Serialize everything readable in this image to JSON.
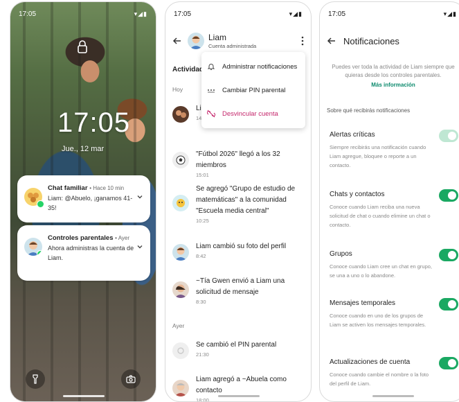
{
  "lockscreen": {
    "status_time": "17:05",
    "status_icons": "▾◢▮",
    "time": "17:05",
    "date": "Jue., 12 mar",
    "notifications": [
      {
        "title": "Chat familiar",
        "meta": "• Hace 10 min",
        "text": "Liam: @Abuelo, ¡ganamos 41-35!"
      },
      {
        "title": "Controles parentales",
        "meta": "• Ayer",
        "text": "Ahora administras la cuenta de Liam."
      }
    ]
  },
  "chatinfo": {
    "status_time": "17:05",
    "status_icons": "▾◢▮",
    "name": "Liam",
    "subtitle": "Cuenta administrada",
    "section": "Actividad",
    "menu": [
      {
        "label": "Administrar notificaciones",
        "icon": "bell-icon"
      },
      {
        "label": "Cambiar PIN parental",
        "icon": "pin-dots-icon"
      },
      {
        "label": "Desvincular cuenta",
        "icon": "unlink-icon"
      }
    ],
    "day_today": "Hoy",
    "day_yesterday": "Ayer",
    "activity": [
      {
        "text": "Li en",
        "time": "14:"
      },
      {
        "text": "\"Fútbol 2026\" llegó a los 32 miembros",
        "time": "15:01"
      },
      {
        "text": "Se agregó \"Grupo de estudio de matemáticas\" a la comunidad \"Escuela media central\"",
        "time": "10:25"
      },
      {
        "text": "Liam cambió su foto del perfil",
        "time": "8:42"
      },
      {
        "text": "~Tía Gwen envió a Liam una solicitud de mensaje",
        "time": "8:30"
      },
      {
        "text": "Se cambió el PIN parental",
        "time": "21:30"
      },
      {
        "text": "Liam agregó a ~Abuela como contacto",
        "time": "18:00"
      }
    ]
  },
  "settings": {
    "status_time": "17:05",
    "status_icons": "▾◢▮",
    "title": "Notificaciones",
    "intro": "Puedes ver toda la actividad de Liam siempre que quieras desde los controles parentales.",
    "link": "Más información",
    "subheading": "Sobre qué recibirás notificaciones",
    "items": [
      {
        "title": "Alertas críticas",
        "desc": "Siempre recibirás una notificación cuando Liam agregue, bloquee o reporte a un contacto.",
        "enabled": true,
        "locked": true
      },
      {
        "title": "Chats y contactos",
        "desc": "Conoce cuando Liam reciba una nueva solicitud de chat o cuando elimine un chat o contacto.",
        "enabled": true,
        "locked": false
      },
      {
        "title": "Grupos",
        "desc": "Conoce cuando Liam cree un chat en grupo, se una a uno o lo abandone.",
        "enabled": true,
        "locked": false
      },
      {
        "title": "Mensajes temporales",
        "desc": "Conoce cuando en uno de los grupos de Liam se activen los mensajes temporales.",
        "enabled": true,
        "locked": false
      },
      {
        "title": "Actualizaciones de cuenta",
        "desc": "Conoce cuando cambie el nombre o la foto del perfil de Liam.",
        "enabled": true,
        "locked": false
      }
    ],
    "colors": {
      "accent": "#1aa862",
      "link": "#0c8a6d",
      "danger": "#c4266b"
    }
  }
}
